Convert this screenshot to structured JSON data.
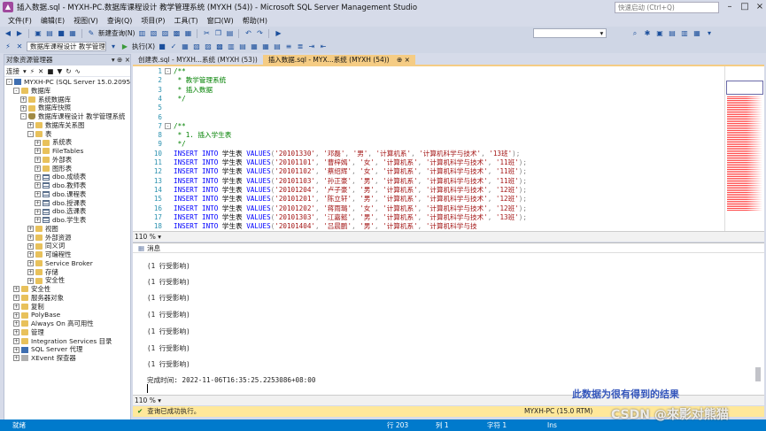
{
  "window": {
    "title": "插入数据.sql - MYXH-PC.数据库课程设计 教学管理系统 (MYXH (54)) - Microsoft SQL Server Management Studio",
    "quick_launch_placeholder": "快速启动 (Ctrl+Q)"
  },
  "menu": [
    "文件(F)",
    "编辑(E)",
    "视图(V)",
    "查询(Q)",
    "项目(P)",
    "工具(T)",
    "窗口(W)",
    "帮助(H)"
  ],
  "toolbar": {
    "new_query": "新建查询(N)",
    "database": "数据库课程设计 教学管理系统",
    "execute": "执行(X)"
  },
  "object_explorer": {
    "title": "对象资源管理器",
    "connect": "连接",
    "tree": [
      {
        "label": "MYXH-PC (SQL Server 15.0.2095.3 - M",
        "level": 0,
        "exp": "-",
        "icon": "server"
      },
      {
        "label": "数据库",
        "level": 1,
        "exp": "-",
        "icon": "folder"
      },
      {
        "label": "系统数据库",
        "level": 2,
        "exp": "+",
        "icon": "folder"
      },
      {
        "label": "数据库快照",
        "level": 2,
        "exp": "+",
        "icon": "folder"
      },
      {
        "label": "数据库课程设计 教学管理系统",
        "level": 2,
        "exp": "-",
        "icon": "db"
      },
      {
        "label": "数据库关系图",
        "level": 3,
        "exp": "+",
        "icon": "folder"
      },
      {
        "label": "表",
        "level": 3,
        "exp": "-",
        "icon": "folder"
      },
      {
        "label": "系统表",
        "level": 4,
        "exp": "+",
        "icon": "folder"
      },
      {
        "label": "FileTables",
        "level": 4,
        "exp": "+",
        "icon": "folder"
      },
      {
        "label": "外部表",
        "level": 4,
        "exp": "+",
        "icon": "folder"
      },
      {
        "label": "图形表",
        "level": 4,
        "exp": "+",
        "icon": "folder"
      },
      {
        "label": "dbo.成绩表",
        "level": 4,
        "exp": "+",
        "icon": "table"
      },
      {
        "label": "dbo.教师表",
        "level": 4,
        "exp": "+",
        "icon": "table"
      },
      {
        "label": "dbo.课程表",
        "level": 4,
        "exp": "+",
        "icon": "table"
      },
      {
        "label": "dbo.授课表",
        "level": 4,
        "exp": "+",
        "icon": "table"
      },
      {
        "label": "dbo.选课表",
        "level": 4,
        "exp": "+",
        "icon": "table"
      },
      {
        "label": "dbo.学生表",
        "level": 4,
        "exp": "+",
        "icon": "table"
      },
      {
        "label": "视图",
        "level": 3,
        "exp": "+",
        "icon": "folder"
      },
      {
        "label": "外部资源",
        "level": 3,
        "exp": "+",
        "icon": "folder"
      },
      {
        "label": "同义词",
        "level": 3,
        "exp": "+",
        "icon": "folder"
      },
      {
        "label": "可编程性",
        "level": 3,
        "exp": "+",
        "icon": "folder"
      },
      {
        "label": "Service Broker",
        "level": 3,
        "exp": "+",
        "icon": "folder"
      },
      {
        "label": "存储",
        "level": 3,
        "exp": "+",
        "icon": "folder"
      },
      {
        "label": "安全性",
        "level": 3,
        "exp": "+",
        "icon": "folder"
      },
      {
        "label": "安全性",
        "level": 1,
        "exp": "+",
        "icon": "folder"
      },
      {
        "label": "服务器对象",
        "level": 1,
        "exp": "+",
        "icon": "folder"
      },
      {
        "label": "复制",
        "level": 1,
        "exp": "+",
        "icon": "folder"
      },
      {
        "label": "PolyBase",
        "level": 1,
        "exp": "+",
        "icon": "folder"
      },
      {
        "label": "Always On 高可用性",
        "level": 1,
        "exp": "+",
        "icon": "folder"
      },
      {
        "label": "管理",
        "level": 1,
        "exp": "+",
        "icon": "folder"
      },
      {
        "label": "Integration Services 目录",
        "level": 1,
        "exp": "+",
        "icon": "folder"
      },
      {
        "label": "SQL Server 代理",
        "level": 1,
        "exp": "+",
        "icon": "server"
      },
      {
        "label": "XEvent 探查器",
        "level": 1,
        "exp": "+",
        "icon": "xe"
      }
    ]
  },
  "tabs": [
    {
      "label": "创建表.sql - MYXH...系统 (MYXH (53))",
      "active": false
    },
    {
      "label": "插入数据.sql - MYX...系统 (MYXH (54))",
      "active": true,
      "pin": "⊕ ×"
    }
  ],
  "editor": {
    "lines": [
      {
        "n": "1",
        "parts": [
          [
            "cm",
            "/**"
          ]
        ]
      },
      {
        "n": "2",
        "parts": [
          [
            "cm",
            " * 教学管理系统"
          ]
        ]
      },
      {
        "n": "3",
        "parts": [
          [
            "cm",
            " * 插入数据"
          ]
        ]
      },
      {
        "n": "4",
        "parts": [
          [
            "cm",
            " */"
          ]
        ]
      },
      {
        "n": "5",
        "parts": []
      },
      {
        "n": "6",
        "parts": []
      },
      {
        "n": "7",
        "parts": [
          [
            "cm",
            "/**"
          ]
        ]
      },
      {
        "n": "8",
        "parts": [
          [
            "cm",
            " * 1. 插入学生表"
          ]
        ]
      },
      {
        "n": "9",
        "parts": [
          [
            "cm",
            " */"
          ]
        ]
      },
      {
        "n": "10",
        "parts": [
          [
            "kw",
            "INSERT INTO "
          ],
          [
            "tbl",
            "学生表 "
          ],
          [
            "kw",
            "VALUES"
          ],
          [
            "pun",
            "("
          ],
          [
            "str",
            "'20101330'"
          ],
          [
            "pun",
            ", "
          ],
          [
            "str",
            "'邓磊'"
          ],
          [
            "pun",
            ", "
          ],
          [
            "str",
            "'男'"
          ],
          [
            "pun",
            ", "
          ],
          [
            "str",
            "'计算机系'"
          ],
          [
            "pun",
            ", "
          ],
          [
            "str",
            "'计算机科学与技术'"
          ],
          [
            "pun",
            ", "
          ],
          [
            "str",
            "'13班'"
          ],
          [
            "pun",
            ");"
          ]
        ]
      },
      {
        "n": "11",
        "parts": [
          [
            "kw",
            "INSERT INTO "
          ],
          [
            "tbl",
            "学生表 "
          ],
          [
            "kw",
            "VALUES"
          ],
          [
            "pun",
            "("
          ],
          [
            "str",
            "'20101101'"
          ],
          [
            "pun",
            ", "
          ],
          [
            "str",
            "'曹梓嫣'"
          ],
          [
            "pun",
            ", "
          ],
          [
            "str",
            "'女'"
          ],
          [
            "pun",
            ", "
          ],
          [
            "str",
            "'计算机系'"
          ],
          [
            "pun",
            ", "
          ],
          [
            "str",
            "'计算机科学与技术'"
          ],
          [
            "pun",
            ", "
          ],
          [
            "str",
            "'11班'"
          ],
          [
            "pun",
            ");"
          ]
        ]
      },
      {
        "n": "12",
        "parts": [
          [
            "kw",
            "INSERT INTO "
          ],
          [
            "tbl",
            "学生表 "
          ],
          [
            "kw",
            "VALUES"
          ],
          [
            "pun",
            "("
          ],
          [
            "str",
            "'20101102'"
          ],
          [
            "pun",
            ", "
          ],
          [
            "str",
            "'蔡绍辉'"
          ],
          [
            "pun",
            ", "
          ],
          [
            "str",
            "'女'"
          ],
          [
            "pun",
            ", "
          ],
          [
            "str",
            "'计算机系'"
          ],
          [
            "pun",
            ", "
          ],
          [
            "str",
            "'计算机科学与技术'"
          ],
          [
            "pun",
            ", "
          ],
          [
            "str",
            "'11班'"
          ],
          [
            "pun",
            ");"
          ]
        ]
      },
      {
        "n": "13",
        "parts": [
          [
            "kw",
            "INSERT INTO "
          ],
          [
            "tbl",
            "学生表 "
          ],
          [
            "kw",
            "VALUES"
          ],
          [
            "pun",
            "("
          ],
          [
            "str",
            "'20101103'"
          ],
          [
            "pun",
            ", "
          ],
          [
            "str",
            "'孙正豪'"
          ],
          [
            "pun",
            ", "
          ],
          [
            "str",
            "'男'"
          ],
          [
            "pun",
            ", "
          ],
          [
            "str",
            "'计算机系'"
          ],
          [
            "pun",
            ", "
          ],
          [
            "str",
            "'计算机科学与技术'"
          ],
          [
            "pun",
            ", "
          ],
          [
            "str",
            "'11班'"
          ],
          [
            "pun",
            ");"
          ]
        ]
      },
      {
        "n": "14",
        "parts": [
          [
            "kw",
            "INSERT INTO "
          ],
          [
            "tbl",
            "学生表 "
          ],
          [
            "kw",
            "VALUES"
          ],
          [
            "pun",
            "("
          ],
          [
            "str",
            "'20101204'"
          ],
          [
            "pun",
            ", "
          ],
          [
            "str",
            "'卢子豪'"
          ],
          [
            "pun",
            ", "
          ],
          [
            "str",
            "'男'"
          ],
          [
            "pun",
            ", "
          ],
          [
            "str",
            "'计算机系'"
          ],
          [
            "pun",
            ", "
          ],
          [
            "str",
            "'计算机科学与技术'"
          ],
          [
            "pun",
            ", "
          ],
          [
            "str",
            "'12班'"
          ],
          [
            "pun",
            ");"
          ]
        ]
      },
      {
        "n": "15",
        "parts": [
          [
            "kw",
            "INSERT INTO "
          ],
          [
            "tbl",
            "学生表 "
          ],
          [
            "kw",
            "VALUES"
          ],
          [
            "pun",
            "("
          ],
          [
            "str",
            "'20101201'"
          ],
          [
            "pun",
            ", "
          ],
          [
            "str",
            "'陈立轩'"
          ],
          [
            "pun",
            ", "
          ],
          [
            "str",
            "'男'"
          ],
          [
            "pun",
            ", "
          ],
          [
            "str",
            "'计算机系'"
          ],
          [
            "pun",
            ", "
          ],
          [
            "str",
            "'计算机科学与技术'"
          ],
          [
            "pun",
            ", "
          ],
          [
            "str",
            "'12班'"
          ],
          [
            "pun",
            ");"
          ]
        ]
      },
      {
        "n": "16",
        "parts": [
          [
            "kw",
            "INSERT INTO "
          ],
          [
            "tbl",
            "学生表 "
          ],
          [
            "kw",
            "VALUES"
          ],
          [
            "pun",
            "("
          ],
          [
            "str",
            "'20101202'"
          ],
          [
            "pun",
            ", "
          ],
          [
            "str",
            "'蒋雨璐'"
          ],
          [
            "pun",
            ", "
          ],
          [
            "str",
            "'女'"
          ],
          [
            "pun",
            ", "
          ],
          [
            "str",
            "'计算机系'"
          ],
          [
            "pun",
            ", "
          ],
          [
            "str",
            "'计算机科学与技术'"
          ],
          [
            "pun",
            ", "
          ],
          [
            "str",
            "'12班'"
          ],
          [
            "pun",
            ");"
          ]
        ]
      },
      {
        "n": "17",
        "parts": [
          [
            "kw",
            "INSERT INTO "
          ],
          [
            "tbl",
            "学生表 "
          ],
          [
            "kw",
            "VALUES"
          ],
          [
            "pun",
            "("
          ],
          [
            "str",
            "'20101303'"
          ],
          [
            "pun",
            ", "
          ],
          [
            "str",
            "'江嘉懿'"
          ],
          [
            "pun",
            ", "
          ],
          [
            "str",
            "'男'"
          ],
          [
            "pun",
            ", "
          ],
          [
            "str",
            "'计算机系'"
          ],
          [
            "pun",
            ", "
          ],
          [
            "str",
            "'计算机科学与技术'"
          ],
          [
            "pun",
            ", "
          ],
          [
            "str",
            "'13班'"
          ],
          [
            "pun",
            ");"
          ]
        ]
      },
      {
        "n": "18",
        "parts": [
          [
            "kw",
            "INSERT INTO "
          ],
          [
            "tbl",
            "学生表 "
          ],
          [
            "kw",
            "VALUES"
          ],
          [
            "pun",
            "("
          ],
          [
            "str",
            "'20101404'"
          ],
          [
            "pun",
            ", "
          ],
          [
            "str",
            "'吕晨鹏'"
          ],
          [
            "pun",
            ", "
          ],
          [
            "str",
            "'男'"
          ],
          [
            "pun",
            ", "
          ],
          [
            "str",
            "'计算机系'"
          ],
          [
            "pun",
            ", "
          ],
          [
            "str",
            "'计算机科学与技"
          ]
        ]
      }
    ],
    "zoom": "110 %"
  },
  "results": {
    "tab_label": "消息",
    "messages": [
      "(1 行受影响)",
      "(1 行受影响)",
      "(1 行受影响)",
      "(1 行受影响)",
      "(1 行受影响)",
      "(1 行受影响)",
      "(1 行受影响)"
    ],
    "completion": "完成时间: 2022-11-06T16:35:25.2253086+08:00",
    "zoom": "110 %"
  },
  "query_status": {
    "message": "查询已成功执行。",
    "server": "MYXH-PC (15.0 RTM)",
    "user": "MYXH-PC\\MYXH (54)",
    "database": "数据库课程设计 教学管理系统",
    "time": "00:00:00",
    "rows": "0 行"
  },
  "statusbar": {
    "ready": "就绪",
    "row": "行 203",
    "col": "列 1",
    "char": "字符 1",
    "ins": "Ins"
  },
  "watermarks": {
    "notice": "此数据为很有得到的结果",
    "csdn": "CSDN @來影对熊猫"
  }
}
